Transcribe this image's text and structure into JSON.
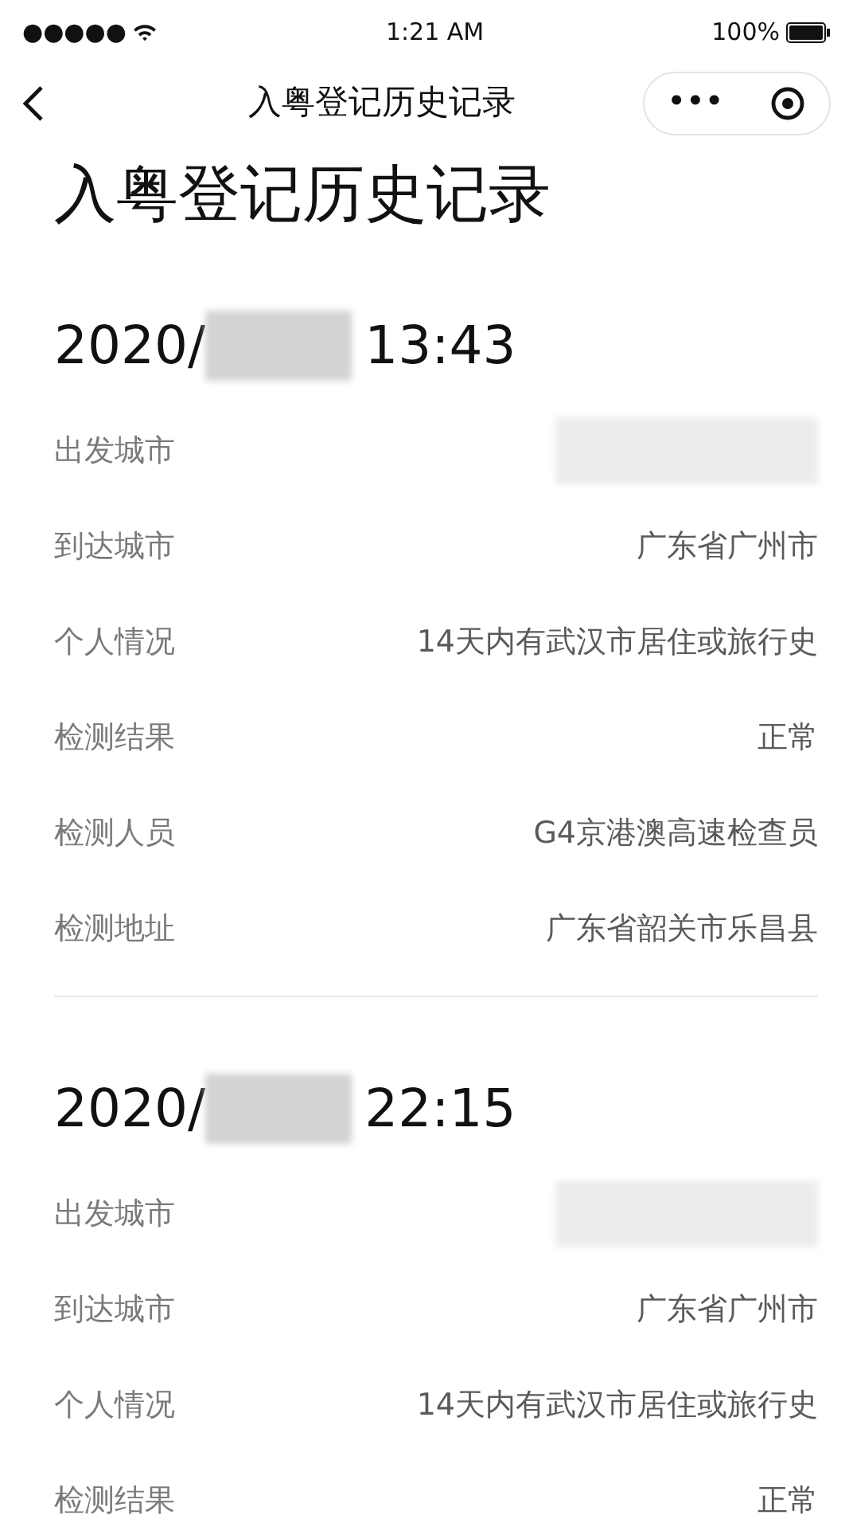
{
  "status_bar": {
    "signal": "●●●●●",
    "time": "1:21 AM",
    "battery": "100%"
  },
  "nav": {
    "title": "入粤登记历史记录",
    "more": "•••"
  },
  "page_title": "入粤登记历史记录",
  "records": [
    {
      "date_prefix": "2020/",
      "time": "13:43",
      "divider": true,
      "fields": [
        {
          "label": "出发城市",
          "kind": "redacted"
        },
        {
          "label": "到达城市",
          "kind": "text",
          "value": "广东省广州市"
        },
        {
          "label": "个人情况",
          "kind": "text",
          "value": "14天内有武汉市居住或旅行史"
        },
        {
          "label": "检测结果",
          "kind": "text",
          "value": "正常"
        },
        {
          "label": "检测人员",
          "kind": "text",
          "value": "G4京港澳高速检查员"
        },
        {
          "label": "检测地址",
          "kind": "text",
          "value": "广东省韶关市乐昌县"
        }
      ]
    },
    {
      "date_prefix": "2020/",
      "time": "22:15",
      "divider": false,
      "fields": [
        {
          "label": "出发城市",
          "kind": "redacted"
        },
        {
          "label": "到达城市",
          "kind": "text",
          "value": "广东省广州市"
        },
        {
          "label": "个人情况",
          "kind": "text",
          "value": "14天内有武汉市居住或旅行史"
        },
        {
          "label": "检测结果",
          "kind": "text",
          "value": "正常"
        }
      ]
    }
  ]
}
